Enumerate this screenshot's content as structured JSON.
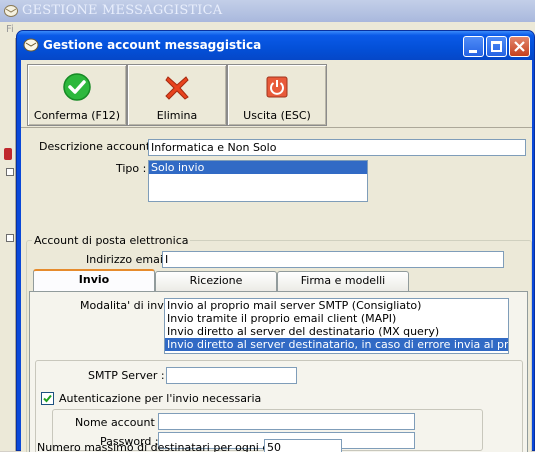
{
  "background_app": {
    "title": "GESTIONE MESSAGGISTICA",
    "menu_hint": "Fi"
  },
  "dialog": {
    "title": "Gestione account messaggistica",
    "controls": {
      "minimize": "minimize-icon",
      "maximize": "maximize-icon",
      "close": "close-icon"
    }
  },
  "toolbar": {
    "confirm_label": "Conferma (F12)",
    "delete_label": "Elimina",
    "exit_label": "Uscita (ESC)",
    "confirm_icon": "check-icon",
    "delete_icon": "x-icon",
    "exit_icon": "power-icon"
  },
  "form": {
    "descrizione_label": "Descrizione account :",
    "descrizione_value": "Informatica e Non Solo",
    "tipo_label": "Tipo :",
    "tipo_options": [
      "Solo invio"
    ],
    "tipo_selected": "Solo invio"
  },
  "account_group": {
    "title": "Account di posta elettronica",
    "email_label": "Indirizzo email :",
    "email_value": "I"
  },
  "tabs": [
    {
      "label": "Invio",
      "active": true
    },
    {
      "label": "Ricezione",
      "active": false
    },
    {
      "label": "Firma e modelli",
      "active": false
    }
  ],
  "invio": {
    "modalita_label": "Modalita' di invio :",
    "modalita_options": [
      "Invio al proprio mail server SMTP (Consigliato)",
      "Invio tramite il proprio email client (MAPI)",
      "Invio diretto al server del destinatario (MX query)",
      "Invio diretto al server destinatario, in caso di errore invia al proprio SMTF"
    ],
    "modalita_selected_index": 3,
    "smtp_label": "SMTP Server :",
    "smtp_value": "",
    "auth_checkbox_label": "Autenticazione per l'invio necessaria",
    "auth_checked": true,
    "nome_account_label": "Nome account :",
    "nome_account_value": "",
    "password_label": "Password :",
    "password_value": "",
    "max_dest_label": "Numero massimo di destinatari per ogni email :",
    "max_dest_value": "50"
  },
  "colors": {
    "titlebar_blue": "#0450d8",
    "selection": "#316ac5",
    "window_bg": "#ece9d8",
    "tab_accent": "#e68b2c"
  }
}
